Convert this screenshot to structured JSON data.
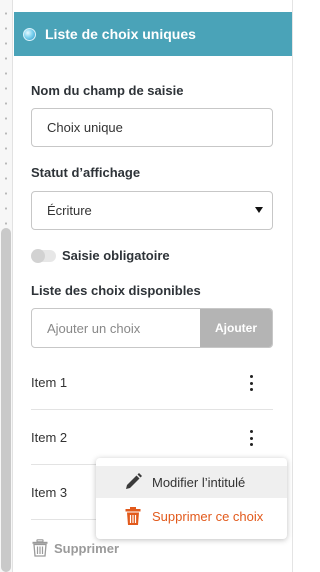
{
  "header": {
    "title": "Liste de choix uniques"
  },
  "field_name": {
    "label": "Nom du champ de saisie",
    "value": "Choix unique"
  },
  "display_status": {
    "label": "Statut d’affichage",
    "selected": "Écriture"
  },
  "required_toggle": {
    "label": "Saisie obligatoire",
    "checked": false
  },
  "choices": {
    "label": "Liste des choix disponibles",
    "add_placeholder": "Ajouter un choix",
    "add_button": "Ajouter",
    "items": [
      {
        "label": "Item 1"
      },
      {
        "label": "Item 2"
      },
      {
        "label": "Item 3"
      }
    ]
  },
  "context_menu": {
    "edit_label": "Modifier l’intitulé",
    "delete_label": "Supprimer ce choix"
  },
  "footer": {
    "delete_label": "Supprimer"
  },
  "colors": {
    "header_bg": "#4aa3b8",
    "danger": "#e25a1c",
    "button_disabled": "#b4b4b4"
  },
  "icons": {
    "header": "radio-dot-icon",
    "edit": "pencil-icon",
    "delete": "trash-icon",
    "menu": "kebab-icon"
  }
}
